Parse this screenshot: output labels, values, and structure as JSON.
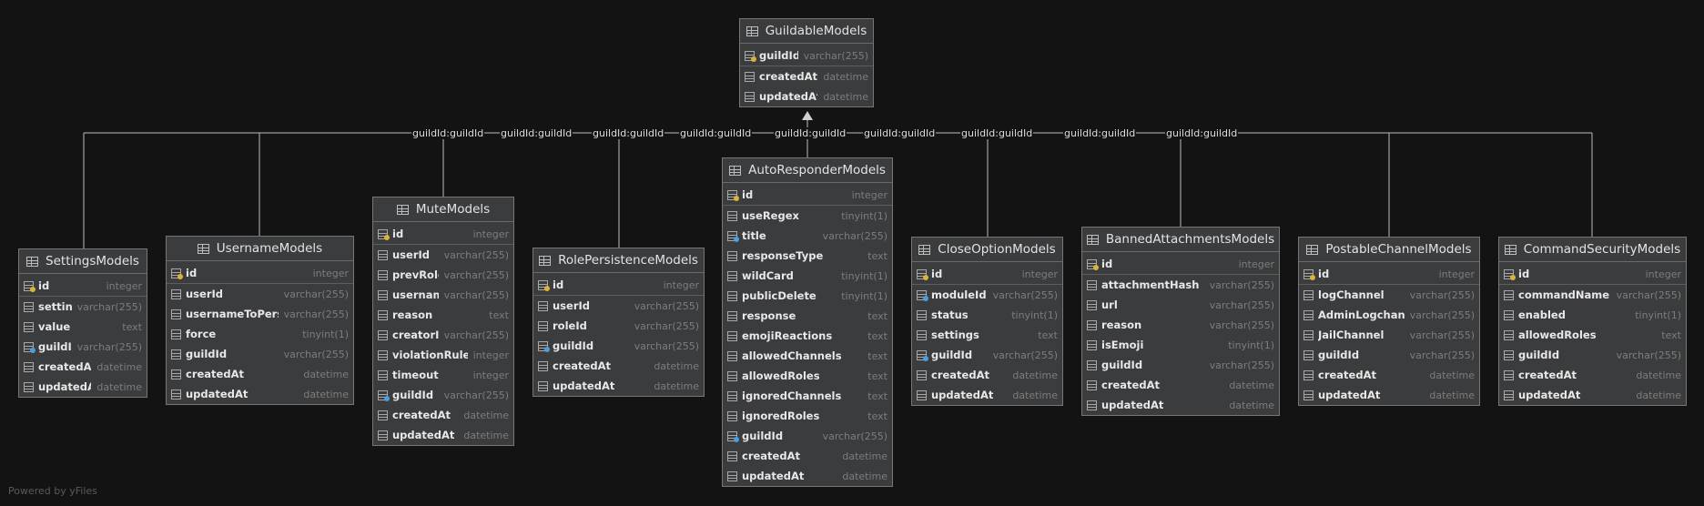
{
  "relation_label": "guildId:guildId",
  "footer": "Powered by yFiles",
  "colors": {
    "background": "#131313",
    "table_bg": "#3b3c3e",
    "pk_key": "#d9b33a",
    "fk_key": "#4c9ed9"
  },
  "parent": {
    "name": "GuildableModels",
    "columns": [
      {
        "name": "guildId",
        "type": "varchar(255)",
        "key": "pk"
      },
      {
        "name": "createdAt",
        "type": "datetime",
        "key": ""
      },
      {
        "name": "updatedAt",
        "type": "datetime",
        "key": ""
      }
    ]
  },
  "tables": [
    {
      "name": "SettingsModels",
      "columns": [
        {
          "name": "id",
          "type": "integer",
          "key": "pk"
        },
        {
          "name": "setting",
          "type": "varchar(255)",
          "key": ""
        },
        {
          "name": "value",
          "type": "text",
          "key": ""
        },
        {
          "name": "guildId",
          "type": "varchar(255)",
          "key": "fk"
        },
        {
          "name": "createdAt",
          "type": "datetime",
          "key": ""
        },
        {
          "name": "updatedAt",
          "type": "datetime",
          "key": ""
        }
      ]
    },
    {
      "name": "UsernameModels",
      "columns": [
        {
          "name": "id",
          "type": "integer",
          "key": "pk"
        },
        {
          "name": "userId",
          "type": "varchar(255)",
          "key": ""
        },
        {
          "name": "usernameToPersist",
          "type": "varchar(255)",
          "key": ""
        },
        {
          "name": "force",
          "type": "tinyint(1)",
          "key": ""
        },
        {
          "name": "guildId",
          "type": "varchar(255)",
          "key": ""
        },
        {
          "name": "createdAt",
          "type": "datetime",
          "key": ""
        },
        {
          "name": "updatedAt",
          "type": "datetime",
          "key": ""
        }
      ]
    },
    {
      "name": "MuteModels",
      "columns": [
        {
          "name": "id",
          "type": "integer",
          "key": "pk"
        },
        {
          "name": "userId",
          "type": "varchar(255)",
          "key": ""
        },
        {
          "name": "prevRole",
          "type": "varchar(255)",
          "key": ""
        },
        {
          "name": "username",
          "type": "varchar(255)",
          "key": ""
        },
        {
          "name": "reason",
          "type": "text",
          "key": ""
        },
        {
          "name": "creatorID",
          "type": "varchar(255)",
          "key": ""
        },
        {
          "name": "violationRules",
          "type": "integer",
          "key": ""
        },
        {
          "name": "timeout",
          "type": "integer",
          "key": ""
        },
        {
          "name": "guildId",
          "type": "varchar(255)",
          "key": "fk"
        },
        {
          "name": "createdAt",
          "type": "datetime",
          "key": ""
        },
        {
          "name": "updatedAt",
          "type": "datetime",
          "key": ""
        }
      ]
    },
    {
      "name": "RolePersistenceModels",
      "columns": [
        {
          "name": "id",
          "type": "integer",
          "key": "pk"
        },
        {
          "name": "userId",
          "type": "varchar(255)",
          "key": ""
        },
        {
          "name": "roleId",
          "type": "varchar(255)",
          "key": ""
        },
        {
          "name": "guildId",
          "type": "varchar(255)",
          "key": "fk"
        },
        {
          "name": "createdAt",
          "type": "datetime",
          "key": ""
        },
        {
          "name": "updatedAt",
          "type": "datetime",
          "key": ""
        }
      ]
    },
    {
      "name": "AutoResponderModels",
      "columns": [
        {
          "name": "id",
          "type": "integer",
          "key": "pk"
        },
        {
          "name": "useRegex",
          "type": "tinyint(1)",
          "key": ""
        },
        {
          "name": "title",
          "type": "varchar(255)",
          "key": "fk"
        },
        {
          "name": "responseType",
          "type": "text",
          "key": ""
        },
        {
          "name": "wildCard",
          "type": "tinyint(1)",
          "key": ""
        },
        {
          "name": "publicDelete",
          "type": "tinyint(1)",
          "key": ""
        },
        {
          "name": "response",
          "type": "text",
          "key": ""
        },
        {
          "name": "emojiReactions",
          "type": "text",
          "key": ""
        },
        {
          "name": "allowedChannels",
          "type": "text",
          "key": ""
        },
        {
          "name": "allowedRoles",
          "type": "text",
          "key": ""
        },
        {
          "name": "ignoredChannels",
          "type": "text",
          "key": ""
        },
        {
          "name": "ignoredRoles",
          "type": "text",
          "key": ""
        },
        {
          "name": "guildId",
          "type": "varchar(255)",
          "key": "fk"
        },
        {
          "name": "createdAt",
          "type": "datetime",
          "key": ""
        },
        {
          "name": "updatedAt",
          "type": "datetime",
          "key": ""
        }
      ]
    },
    {
      "name": "CloseOptionModels",
      "columns": [
        {
          "name": "id",
          "type": "integer",
          "key": "pk"
        },
        {
          "name": "moduleId",
          "type": "varchar(255)",
          "key": "fk"
        },
        {
          "name": "status",
          "type": "tinyint(1)",
          "key": ""
        },
        {
          "name": "settings",
          "type": "text",
          "key": ""
        },
        {
          "name": "guildId",
          "type": "varchar(255)",
          "key": "fk"
        },
        {
          "name": "createdAt",
          "type": "datetime",
          "key": ""
        },
        {
          "name": "updatedAt",
          "type": "datetime",
          "key": ""
        }
      ]
    },
    {
      "name": "BannedAttachmentsModels",
      "columns": [
        {
          "name": "id",
          "type": "integer",
          "key": "pk"
        },
        {
          "name": "attachmentHash",
          "type": "varchar(255)",
          "key": ""
        },
        {
          "name": "url",
          "type": "varchar(255)",
          "key": ""
        },
        {
          "name": "reason",
          "type": "varchar(255)",
          "key": ""
        },
        {
          "name": "isEmoji",
          "type": "tinyint(1)",
          "key": ""
        },
        {
          "name": "guildId",
          "type": "varchar(255)",
          "key": ""
        },
        {
          "name": "createdAt",
          "type": "datetime",
          "key": ""
        },
        {
          "name": "updatedAt",
          "type": "datetime",
          "key": ""
        }
      ]
    },
    {
      "name": "PostableChannelModels",
      "columns": [
        {
          "name": "id",
          "type": "integer",
          "key": "pk"
        },
        {
          "name": "logChannel",
          "type": "varchar(255)",
          "key": ""
        },
        {
          "name": "AdminLogchannel",
          "type": "varchar(255)",
          "key": ""
        },
        {
          "name": "JailChannel",
          "type": "varchar(255)",
          "key": ""
        },
        {
          "name": "guildId",
          "type": "varchar(255)",
          "key": ""
        },
        {
          "name": "createdAt",
          "type": "datetime",
          "key": ""
        },
        {
          "name": "updatedAt",
          "type": "datetime",
          "key": ""
        }
      ]
    },
    {
      "name": "CommandSecurityModels",
      "columns": [
        {
          "name": "id",
          "type": "integer",
          "key": "pk"
        },
        {
          "name": "commandName",
          "type": "varchar(255)",
          "key": ""
        },
        {
          "name": "enabled",
          "type": "tinyint(1)",
          "key": ""
        },
        {
          "name": "allowedRoles",
          "type": "text",
          "key": ""
        },
        {
          "name": "guildId",
          "type": "varchar(255)",
          "key": ""
        },
        {
          "name": "createdAt",
          "type": "datetime",
          "key": ""
        },
        {
          "name": "updatedAt",
          "type": "datetime",
          "key": ""
        }
      ]
    }
  ]
}
